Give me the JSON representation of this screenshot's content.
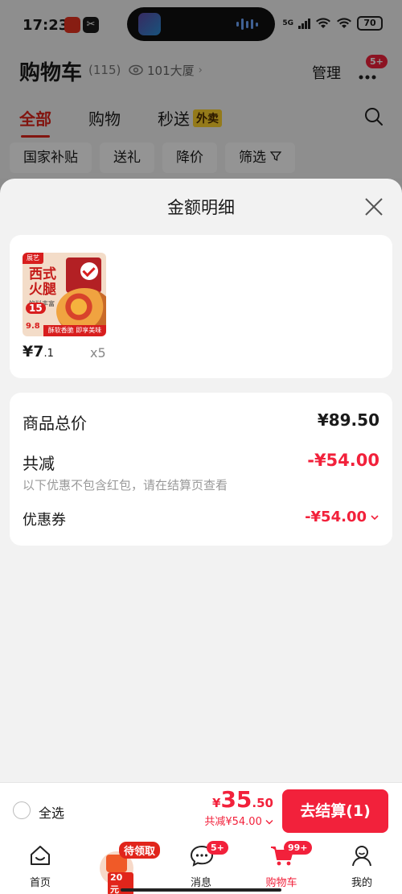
{
  "status": {
    "time": "17:23",
    "network": "5G",
    "battery": "70"
  },
  "header": {
    "title": "购物车",
    "count": "(115)",
    "address": "101大厦",
    "manage": "管理",
    "more_badge": "5+",
    "tabs": [
      {
        "label": "全部",
        "active": true
      },
      {
        "label": "购物",
        "active": false
      },
      {
        "label": "秒送",
        "tag": "外卖",
        "active": false
      }
    ],
    "chips": [
      "国家补贴",
      "送礼",
      "降价",
      "筛选"
    ]
  },
  "sheet": {
    "title": "金额明细",
    "product": {
      "brand": "展艺",
      "name": "西式火腿",
      "sub": "馅料丰富",
      "promo_15": "15",
      "promo_98": "9.8",
      "strip": "酥软香脆 即享美味",
      "price_int": "¥7",
      "price_dec": ".1",
      "qty": "x5"
    },
    "summary": {
      "total_label": "商品总价",
      "total_value": "¥89.50",
      "discount_label": "共减",
      "discount_value": "-¥54.00",
      "discount_note": "以下优惠不包含红包，请在结算页查看",
      "coupon_label": "优惠券",
      "coupon_value": "-¥54.00"
    }
  },
  "checkout": {
    "select_all": "全选",
    "currency": "¥",
    "amount_int": "35",
    "amount_dec": ".50",
    "saved": "共减¥54.00",
    "pay_button": "去结算(1)"
  },
  "tabbar": {
    "home": "首页",
    "coupon_tag": "待领取",
    "coupon_value": "20元",
    "messages": "消息",
    "messages_badge": "5+",
    "cart": "购物车",
    "cart_badge": "99+",
    "mine": "我的"
  },
  "colors": {
    "accent": "#f2213b",
    "brand_red": "#e1251b",
    "tag_yellow": "#ffd22e"
  }
}
